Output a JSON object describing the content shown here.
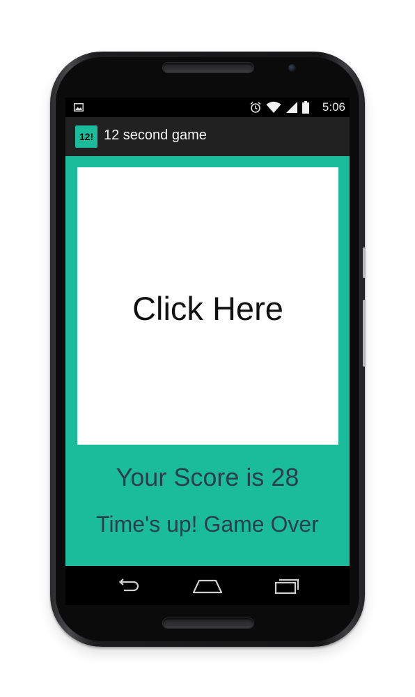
{
  "status_bar": {
    "time": "5:06",
    "icons": [
      "image-notification-icon",
      "alarm-icon",
      "wifi-icon",
      "signal-icon",
      "battery-icon"
    ]
  },
  "app_bar": {
    "icon_text": "12!",
    "title": "12 second game"
  },
  "game": {
    "tap_label": "Click Here",
    "score_text": "Your Score is 28",
    "status_text": "Time's up! Game Over"
  },
  "navigation": {
    "buttons": [
      "back-icon",
      "home-icon",
      "recents-icon"
    ]
  },
  "colors": {
    "accent": "#1abc9c",
    "action_bar": "#212121",
    "text_dark": "#2b3f4a",
    "tap_area": "#ffffff"
  }
}
